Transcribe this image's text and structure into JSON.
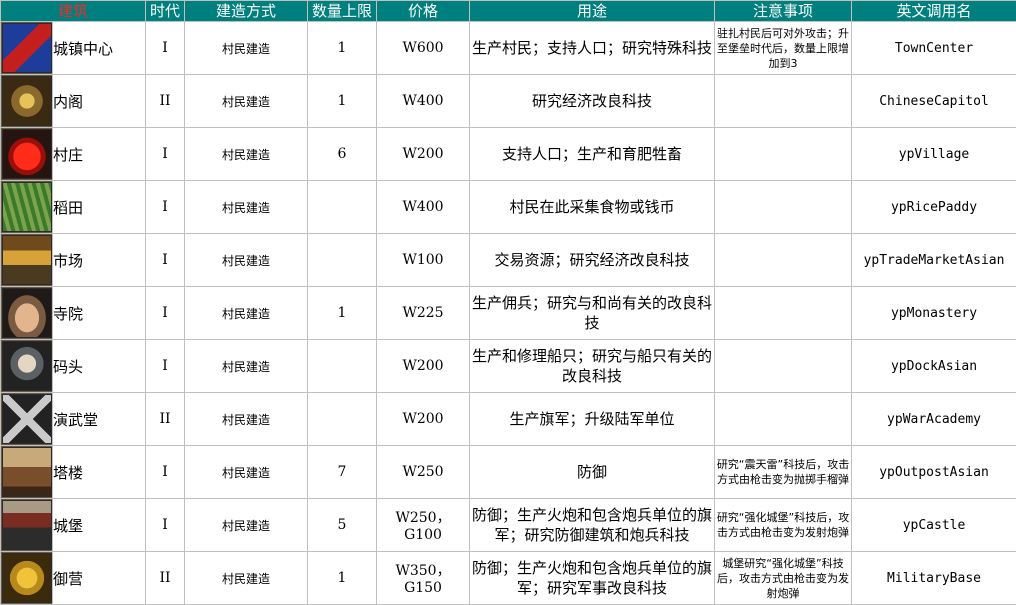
{
  "headers": [
    "建筑",
    "时代",
    "建造方式",
    "数量上限",
    "价格",
    "用途",
    "注意事项",
    "英文调用名"
  ],
  "rows": [
    {
      "icon": "town-center-icon",
      "name": "城镇中心",
      "era": "I",
      "method": "村民建造",
      "limit": "1",
      "price": "W600",
      "use": "生产村民；支持人口；研究特殊科技",
      "note": "驻扎村民后可对外攻击；升至堡垒时代后，数量上限增加到3",
      "eng": "TownCenter"
    },
    {
      "icon": "chinese-capitol-icon",
      "name": "内阁",
      "era": "II",
      "method": "村民建造",
      "limit": "1",
      "price": "W400",
      "use": "研究经济改良科技",
      "note": "",
      "eng": "ChineseCapitol"
    },
    {
      "icon": "lantern-village-icon",
      "name": "村庄",
      "era": "I",
      "method": "村民建造",
      "limit": "6",
      "price": "W200",
      "use": "支持人口；生产和育肥牲畜",
      "note": "",
      "eng": "ypVillage"
    },
    {
      "icon": "rice-paddy-icon",
      "name": "稻田",
      "era": "I",
      "method": "村民建造",
      "limit": "",
      "price": "W400",
      "use": "村民在此采集食物或钱币",
      "note": "",
      "eng": "ypRicePaddy"
    },
    {
      "icon": "trade-market-icon",
      "name": "市场",
      "era": "I",
      "method": "村民建造",
      "limit": "",
      "price": "W100",
      "use": "交易资源；研究经济改良科技",
      "note": "",
      "eng": "ypTradeMarketAsian"
    },
    {
      "icon": "praying-hands-icon",
      "name": "寺院",
      "era": "I",
      "method": "村民建造",
      "limit": "1",
      "price": "W225",
      "use": "生产佣兵；研究与和尚有关的改良科技",
      "note": "",
      "eng": "ypMonastery"
    },
    {
      "icon": "anchor-dock-icon",
      "name": "码头",
      "era": "I",
      "method": "村民建造",
      "limit": "",
      "price": "W200",
      "use": "生产和修理船只；研究与船只有关的改良科技",
      "note": "",
      "eng": "ypDockAsian"
    },
    {
      "icon": "crossed-swords-icon",
      "name": "演武堂",
      "era": "II",
      "method": "村民建造",
      "limit": "",
      "price": "W200",
      "use": "生产旗军；升级陆军单位",
      "note": "",
      "eng": "ypWarAcademy"
    },
    {
      "icon": "watch-tower-icon",
      "name": "塔楼",
      "era": "I",
      "method": "村民建造",
      "limit": "7",
      "price": "W250",
      "use": "防御",
      "note": "研究“震天雷”科技后，攻击方式由枪击变为抛掷手榴弹",
      "eng": "ypOutpostAsian"
    },
    {
      "icon": "castle-icon",
      "name": "城堡",
      "era": "I",
      "method": "村民建造",
      "limit": "5",
      "price": "W250，G100",
      "use": "防御；生产火炮和包含炮兵单位的旗军；研究防御建筑和炮兵科技",
      "note": "研究“强化城堡”科技后，攻击方式由枪击变为发射炮弹",
      "eng": "ypCastle"
    },
    {
      "icon": "dragon-emblem-icon",
      "name": "御营",
      "era": "II",
      "method": "村民建造",
      "limit": "1",
      "price": "W350，G150",
      "use": "防御；生产火炮和包含炮兵单位的旗军；研究军事改良科技",
      "note": "城堡研究“强化城堡”科技后，攻击方式由枪击变为发射炮弹",
      "eng": "MilitaryBase"
    }
  ]
}
